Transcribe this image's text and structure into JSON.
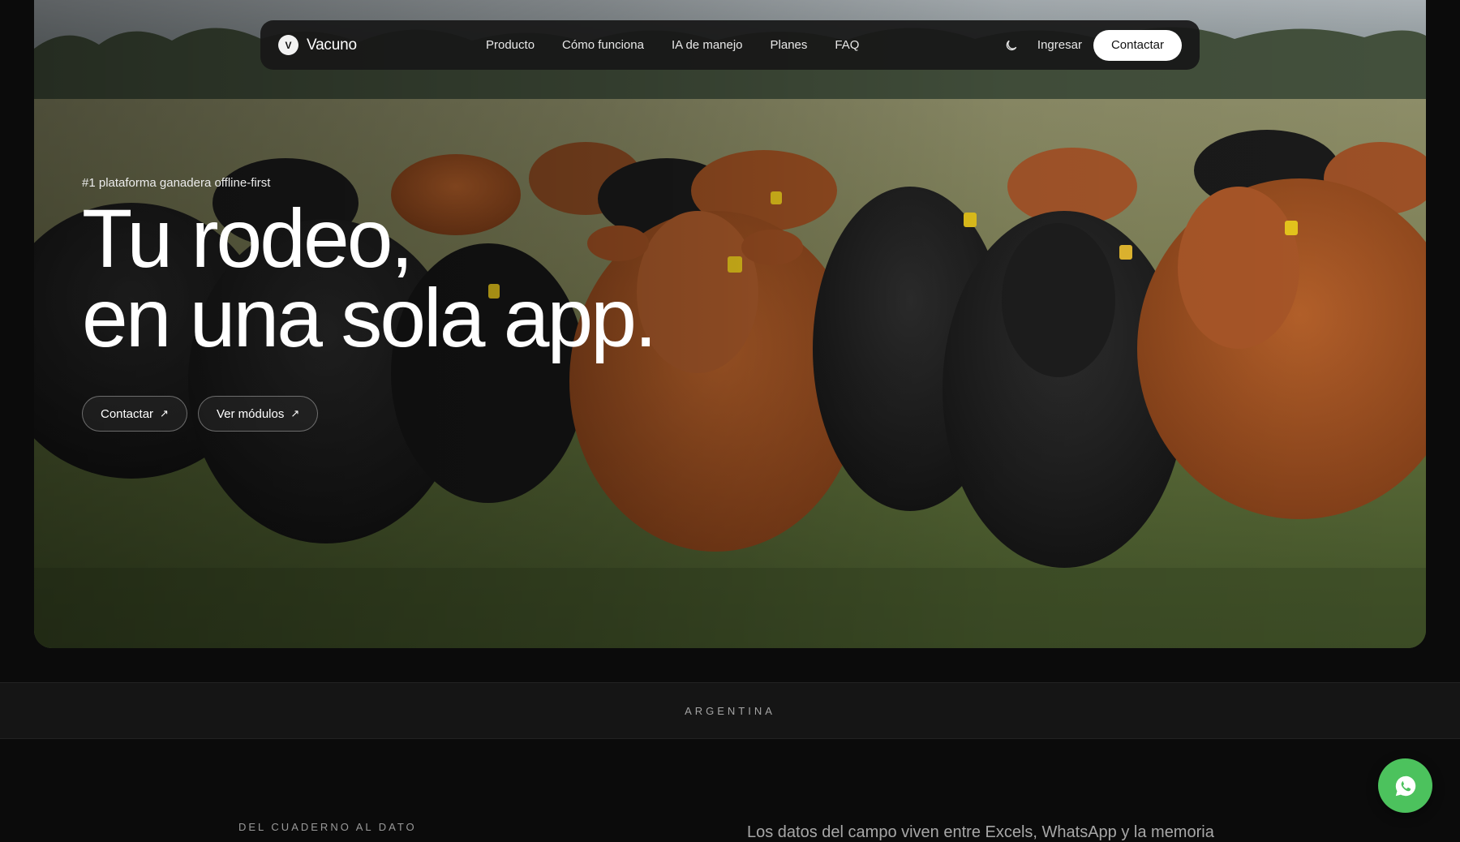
{
  "nav": {
    "brand_initial": "V",
    "brand_name": "Vacuno",
    "links": [
      "Producto",
      "Cómo funciona",
      "IA de manejo",
      "Planes",
      "FAQ"
    ],
    "theme_icon": "moon-icon",
    "login_label": "Ingresar",
    "cta_label": "Contactar"
  },
  "hero": {
    "eyebrow": "#1 plataforma ganadera offline-first",
    "headline_line1": "Tu rodeo,",
    "headline_line2": "en una sola app.",
    "primary_button": "Contactar",
    "secondary_button": "Ver módulos",
    "button_icon": "↗"
  },
  "strip": {
    "label": "ARGENTINA"
  },
  "section": {
    "label": "DEL CUADERNO AL DATO",
    "text": "Los datos del campo viven entre Excels, WhatsApp y la memoria"
  },
  "floating": {
    "whatsapp_icon": "whatsapp-icon",
    "color": "#4cc25d"
  }
}
